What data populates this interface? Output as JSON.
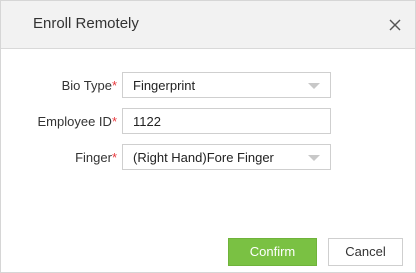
{
  "dialog": {
    "title": "Enroll Remotely",
    "close_label": "×"
  },
  "form": {
    "bio_type": {
      "label": "Bio Type",
      "required_mark": "*",
      "value": "Fingerprint"
    },
    "employee_id": {
      "label": "Employee ID",
      "required_mark": "*",
      "value": "1122"
    },
    "finger": {
      "label": "Finger",
      "required_mark": "*",
      "value": "(Right Hand)Fore Finger"
    }
  },
  "buttons": {
    "confirm_label": "Confirm",
    "cancel_label": "Cancel"
  },
  "colors": {
    "accent_green": "#7ac143",
    "required_red": "#e8383d",
    "titlebar_bg": "#f2f2f2"
  },
  "icons": {
    "close": "close-icon",
    "dropdown": "chevron-down-icon"
  }
}
